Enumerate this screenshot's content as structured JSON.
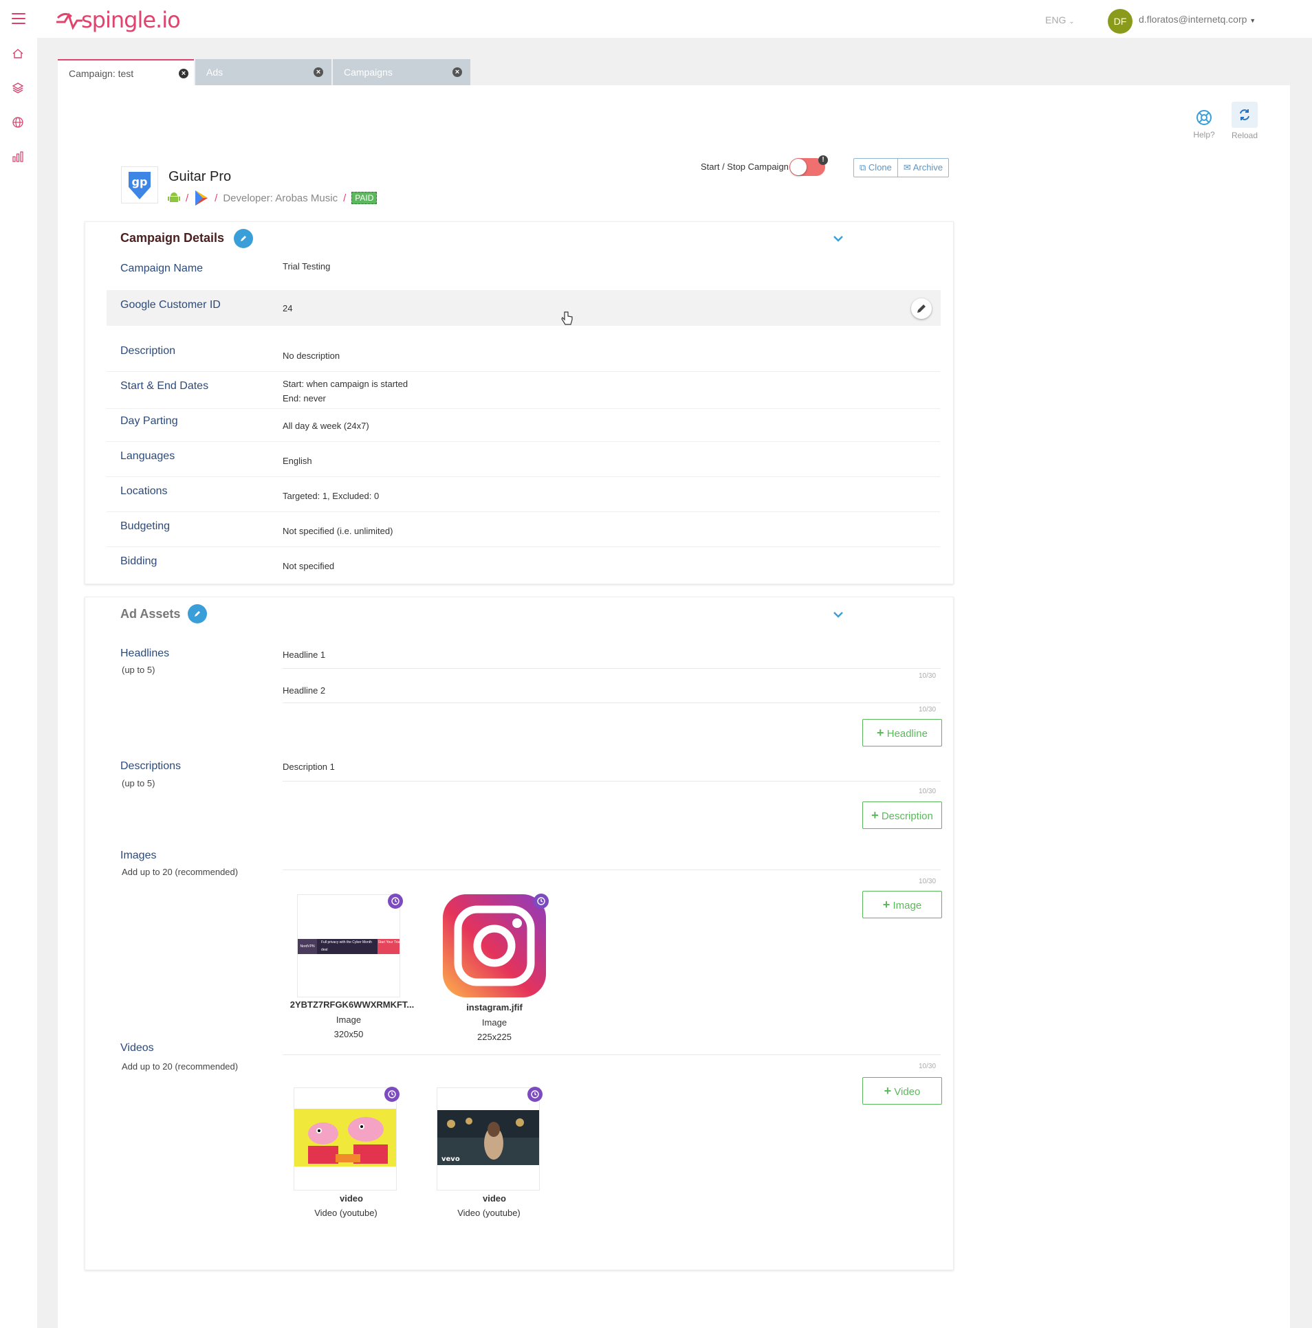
{
  "header": {
    "logo_text": "spingle.io",
    "lang": "ENG",
    "avatar_initials": "DF",
    "user_email": "d.floratos@internetq.corp"
  },
  "tabs": [
    {
      "label": "Campaign: test"
    },
    {
      "label": "Ads"
    },
    {
      "label": "Campaigns"
    }
  ],
  "toolbar": {
    "help_label": "Help?",
    "reload_label": "Reload"
  },
  "app": {
    "name": "Guitar Pro",
    "developer": "Developer: Arobas Music",
    "price_badge": "PAID",
    "slash": "/"
  },
  "controls": {
    "start_stop_label": "Start / Stop Campaign",
    "clone_label": "Clone",
    "archive_label": "Archive"
  },
  "campaign_details": {
    "title": "Campaign Details",
    "rows": [
      {
        "label": "Campaign Name",
        "value": "Trial Testing"
      },
      {
        "label": "Google Customer ID",
        "value": "24"
      },
      {
        "label": "Description",
        "value": "No description"
      },
      {
        "label": "Start & End Dates",
        "value": "Start: when campaign is started",
        "value2": "End: never"
      },
      {
        "label": "Day Parting",
        "value": "All day & week (24x7)"
      },
      {
        "label": "Languages",
        "value": "English"
      },
      {
        "label": "Locations",
        "value": "Targeted: 1, Excluded: 0"
      },
      {
        "label": "Budgeting",
        "value": "Not specified (i.e. unlimited)"
      },
      {
        "label": "Bidding",
        "value": "Not specified"
      }
    ]
  },
  "ad_assets": {
    "title": "Ad Assets",
    "headlines": {
      "label": "Headlines",
      "sublabel": "(up to 5)",
      "items": [
        {
          "text": "Headline 1",
          "counter": "10/30"
        },
        {
          "text": "Headline 2",
          "counter": "10/30"
        }
      ],
      "add_label": "Headline"
    },
    "descriptions": {
      "label": "Descriptions",
      "sublabel": "(up to 5)",
      "items": [
        {
          "text": "Description 1",
          "counter": "10/30"
        }
      ],
      "add_label": "Description"
    },
    "images": {
      "label": "Images",
      "sublabel": "Add up to 20 (recommended)",
      "counter": "10/30",
      "add_label": "Image",
      "items": [
        {
          "name": "2YBTZ7RFGK6WWXRMKFT...",
          "type": "Image",
          "size": "320x50"
        },
        {
          "name": "instagram.jfif",
          "type": "Image",
          "size": "225x225"
        }
      ],
      "banner_text": {
        "brand": "NordVPN",
        "middle": "Full privacy with the Cyber Month deal",
        "cta": "Start Your Trial"
      }
    },
    "videos": {
      "label": "Videos",
      "sublabel": "Add up to 20 (recommended)",
      "counter": "10/30",
      "add_label": "Video",
      "items": [
        {
          "name": "video",
          "type": "Video (youtube)"
        },
        {
          "name": "video",
          "type": "Video (youtube)"
        }
      ],
      "vevo_label": "vevo"
    }
  },
  "colors": {
    "brand": "#e0436c",
    "accent_blue": "#3a9fd8",
    "green": "#5cb85c",
    "label_blue": "#2b4a7a",
    "clock_purple": "#7b4bbf"
  }
}
